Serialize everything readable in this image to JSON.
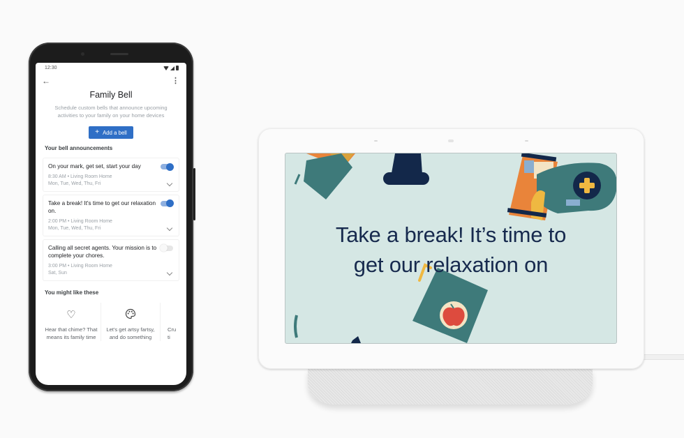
{
  "phone": {
    "status_bar": {
      "time": "12:30"
    },
    "app_bar": {
      "back_icon": "arrow-left-icon",
      "menu_icon": "more-vert-icon"
    },
    "page_title": "Family Bell",
    "subtitle": "Schedule custom bells that announce upcoming activities to your family on your home devices",
    "add_button": {
      "icon": "+",
      "label": "Add a bell"
    },
    "announcements_heading": "Your bell announcements",
    "bells": [
      {
        "title": "On your mark, get set, start your day",
        "time": "8:30 AM • Living Room Home",
        "days": "Mon, Tue, Wed, Thu, Fri",
        "enabled": true
      },
      {
        "title": "Take a break! It's time to get our relaxation on.",
        "time": "2:00 PM • Living Room Home",
        "days": "Mon, Tue, Wed, Thu, Fri",
        "enabled": true
      },
      {
        "title": "Calling all secret agents. Your mission is to complete your chores.",
        "time": "3:00 PM • Living Room Home",
        "days": "Sat, Sun",
        "enabled": false
      }
    ],
    "suggestions_heading": "You might like these",
    "suggestions": [
      {
        "icon": "♡",
        "icon_name": "heart-icon",
        "text": "Hear that chime? That means its family time"
      },
      {
        "icon": "🎨",
        "icon_name": "palette-icon",
        "text": "Let's get artsy fartsy, and do something"
      },
      {
        "icon": "",
        "icon_name": "",
        "text": "Cru ti"
      }
    ]
  },
  "hub": {
    "message_line1": "Take a break! It’s time to",
    "message_line2": "get our relaxation on",
    "colors": {
      "screen_bg": "#d5e7e4",
      "text": "#172a4e",
      "teal": "#3e7a7a",
      "orange": "#e9843a",
      "yellow": "#efb841",
      "navy": "#13284a",
      "red": "#dd4b3e",
      "cream": "#f4e4c4"
    }
  }
}
